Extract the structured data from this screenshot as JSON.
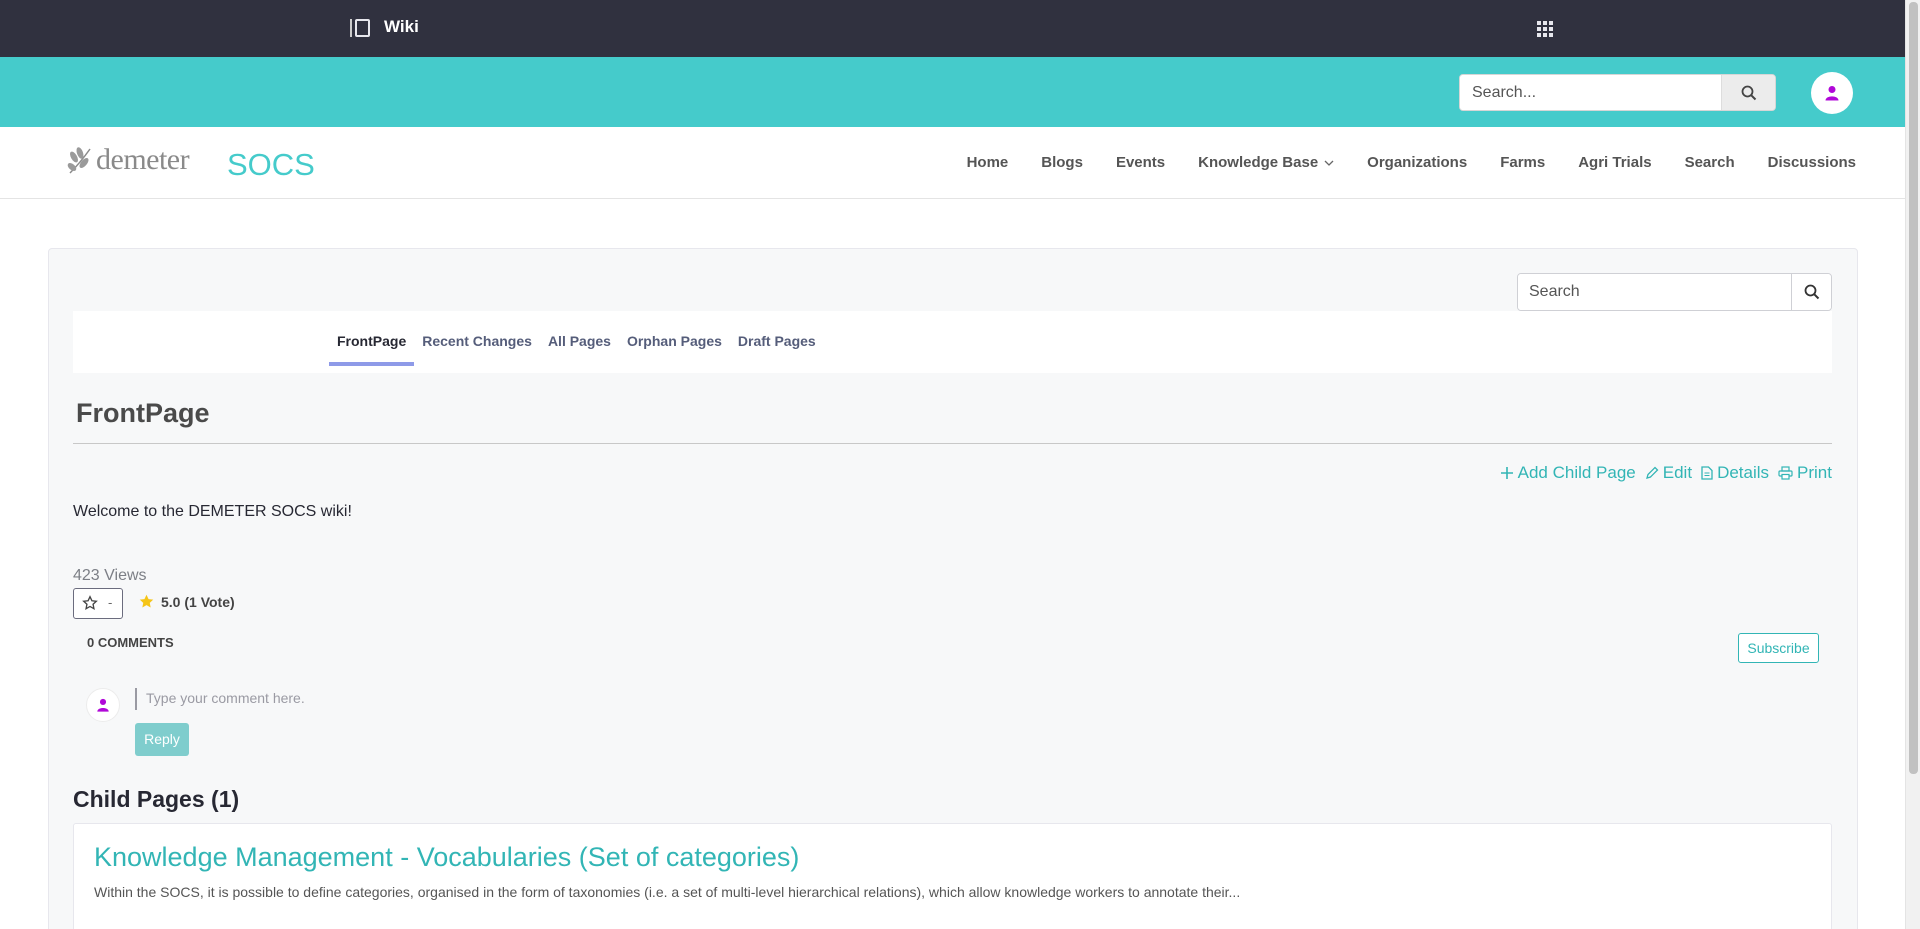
{
  "control_bar": {
    "title": "Wiki"
  },
  "header": {
    "search_placeholder": "Search..."
  },
  "brand": {
    "logo_text": "demeter",
    "site_name": "SOCS"
  },
  "nav": {
    "items": [
      "Home",
      "Blogs",
      "Events",
      "Knowledge Base",
      "Organizations",
      "Farms",
      "Agri Trials",
      "Search",
      "Discussions"
    ]
  },
  "wiki": {
    "search_placeholder": "Search",
    "tabs": [
      "FrontPage",
      "Recent Changes",
      "All Pages",
      "Orphan Pages",
      "Draft Pages"
    ],
    "active_tab": "FrontPage",
    "page_title": "FrontPage",
    "actions": {
      "add_child": "Add Child Page",
      "edit": "Edit",
      "details": "Details",
      "print": "Print"
    },
    "content": "Welcome to the DEMETER SOCS wiki!",
    "views": "423 Views",
    "favorite_count": "-",
    "rating": "5.0 (1 Vote)",
    "comments_count": "0 COMMENTS",
    "subscribe_label": "Subscribe",
    "comment_placeholder": "Type your comment here.",
    "reply_label": "Reply",
    "child_pages_heading": "Child Pages (1)",
    "child_pages": [
      {
        "title": "Knowledge Management - Vocabularies (Set of categories)",
        "description": "Within the SOCS, it is possible to define categories, organised in the form of taxonomies (i.e. a set of multi-level hierarchical relations), which allow knowledge workers to annotate their..."
      }
    ]
  },
  "colors": {
    "control_bar": "#30313f",
    "teal": "#45cbcb",
    "link": "#32b5b5",
    "avatar_accent": "#b008d8",
    "star": "#f5c518"
  }
}
